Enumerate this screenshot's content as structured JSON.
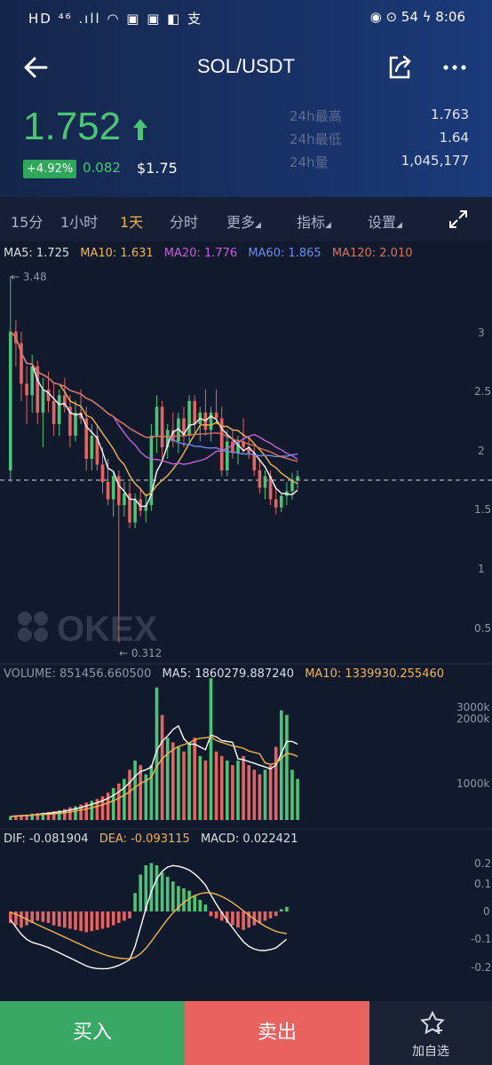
{
  "status_bar": {
    "left": "HD ⁴⁶ .ıll ◠ ▣ ▣ ◧ 支",
    "right": "◉ ⊙ 54 ϟ 8:06"
  },
  "nav": {
    "title": "SOL/USDT"
  },
  "ticker": {
    "price": "1.752",
    "change_pct": "+4.92%",
    "change_abs": "0.082",
    "usd_price": "$1.75",
    "stats": [
      {
        "label": "24h最高",
        "value": "1.763"
      },
      {
        "label": "24h最低",
        "value": "1.64"
      },
      {
        "label": "24h量",
        "value": "1,045,177"
      }
    ]
  },
  "tabs": {
    "items": [
      "15分",
      "1小时",
      "1天",
      "分时",
      "更多",
      "指标",
      "设置"
    ],
    "active": "1天"
  },
  "ma_legend": {
    "ma5": "MA5: 1.725",
    "ma10": "MA10: 1.631",
    "ma20": "MA20: 1.776",
    "ma60": "MA60: 1.865",
    "ma120": "MA120: 2.010"
  },
  "price_axis": {
    "ticks": [
      "3",
      "2.5",
      "2",
      "1.5",
      "1",
      "0.5"
    ],
    "high_marker": "3.48",
    "low_marker": "0.312",
    "watermark": "OKEX"
  },
  "volume_legend": {
    "volume": "VOLUME: 851456.660500",
    "ma5": "MA5: 1860279.887240",
    "ma10": "MA10: 1339930.255460"
  },
  "volume_axis": {
    "ticks": [
      "3000k",
      "2000k",
      "1000k"
    ]
  },
  "macd_legend": {
    "dif": "DIF: -0.081904",
    "dea": "DEA: -0.093115",
    "macd": "MACD: 0.022421"
  },
  "macd_axis": {
    "ticks": [
      "0.2",
      "0.1",
      "0",
      "-0.1",
      "-0.2"
    ]
  },
  "actions": {
    "buy": "买入",
    "sell": "卖出",
    "favorite": "加自选"
  },
  "colors": {
    "up": "#49c574",
    "down": "#e8625f",
    "ma5": "#ffffff",
    "ma10": "#f0b64e",
    "ma20": "#c462d8",
    "ma60": "#6c8cf0",
    "ma120": "#d9735a"
  },
  "chart_data": {
    "type": "candlestick",
    "price_range": [
      0.25,
      3.55
    ],
    "candles": [
      {
        "o": 1.8,
        "h": 3.48,
        "l": 1.7,
        "c": 3.0
      },
      {
        "o": 3.0,
        "h": 3.1,
        "l": 2.7,
        "c": 2.9
      },
      {
        "o": 2.9,
        "h": 3.0,
        "l": 2.4,
        "c": 2.55
      },
      {
        "o": 2.55,
        "h": 2.7,
        "l": 2.2,
        "c": 2.45
      },
      {
        "o": 2.45,
        "h": 2.8,
        "l": 2.3,
        "c": 2.7
      },
      {
        "o": 2.7,
        "h": 2.75,
        "l": 2.2,
        "c": 2.3
      },
      {
        "o": 2.3,
        "h": 2.6,
        "l": 2.0,
        "c": 2.5
      },
      {
        "o": 2.5,
        "h": 2.65,
        "l": 2.3,
        "c": 2.4
      },
      {
        "o": 2.4,
        "h": 2.55,
        "l": 2.1,
        "c": 2.2
      },
      {
        "o": 2.2,
        "h": 2.5,
        "l": 2.1,
        "c": 2.45
      },
      {
        "o": 2.45,
        "h": 2.6,
        "l": 2.3,
        "c": 2.35
      },
      {
        "o": 2.35,
        "h": 2.45,
        "l": 2.0,
        "c": 2.1
      },
      {
        "o": 2.1,
        "h": 2.4,
        "l": 2.05,
        "c": 2.3
      },
      {
        "o": 2.3,
        "h": 2.5,
        "l": 2.2,
        "c": 2.25
      },
      {
        "o": 2.25,
        "h": 2.35,
        "l": 1.8,
        "c": 1.9
      },
      {
        "o": 1.9,
        "h": 2.2,
        "l": 1.8,
        "c": 2.1
      },
      {
        "o": 2.1,
        "h": 2.2,
        "l": 1.8,
        "c": 1.85
      },
      {
        "o": 1.85,
        "h": 2.0,
        "l": 1.6,
        "c": 1.7
      },
      {
        "o": 1.7,
        "h": 1.9,
        "l": 1.5,
        "c": 1.55
      },
      {
        "o": 1.55,
        "h": 1.8,
        "l": 1.4,
        "c": 1.75
      },
      {
        "o": 1.75,
        "h": 1.8,
        "l": 0.312,
        "c": 1.5
      },
      {
        "o": 1.5,
        "h": 1.7,
        "l": 1.4,
        "c": 1.6
      },
      {
        "o": 1.6,
        "h": 1.7,
        "l": 1.3,
        "c": 1.35
      },
      {
        "o": 1.35,
        "h": 1.6,
        "l": 1.3,
        "c": 1.55
      },
      {
        "o": 1.55,
        "h": 1.65,
        "l": 1.4,
        "c": 1.45
      },
      {
        "o": 1.45,
        "h": 1.6,
        "l": 1.35,
        "c": 1.5
      },
      {
        "o": 1.5,
        "h": 2.2,
        "l": 1.45,
        "c": 2.1
      },
      {
        "o": 2.1,
        "h": 2.45,
        "l": 1.95,
        "c": 2.35
      },
      {
        "o": 2.35,
        "h": 2.4,
        "l": 1.9,
        "c": 2.0
      },
      {
        "o": 2.0,
        "h": 2.2,
        "l": 1.9,
        "c": 2.15
      },
      {
        "o": 2.15,
        "h": 2.3,
        "l": 2.0,
        "c": 2.05
      },
      {
        "o": 2.05,
        "h": 2.3,
        "l": 1.95,
        "c": 2.25
      },
      {
        "o": 2.25,
        "h": 2.35,
        "l": 2.0,
        "c": 2.1
      },
      {
        "o": 2.1,
        "h": 2.45,
        "l": 2.05,
        "c": 2.4
      },
      {
        "o": 2.4,
        "h": 2.45,
        "l": 2.1,
        "c": 2.2
      },
      {
        "o": 2.2,
        "h": 2.35,
        "l": 2.05,
        "c": 2.3
      },
      {
        "o": 2.3,
        "h": 2.5,
        "l": 2.1,
        "c": 2.15
      },
      {
        "o": 2.15,
        "h": 2.35,
        "l": 2.05,
        "c": 2.3
      },
      {
        "o": 2.3,
        "h": 2.5,
        "l": 2.2,
        "c": 2.25
      },
      {
        "o": 2.25,
        "h": 2.35,
        "l": 1.75,
        "c": 1.8
      },
      {
        "o": 1.8,
        "h": 2.15,
        "l": 1.75,
        "c": 2.05
      },
      {
        "o": 2.05,
        "h": 2.15,
        "l": 1.9,
        "c": 1.95
      },
      {
        "o": 1.95,
        "h": 2.1,
        "l": 1.85,
        "c": 2.05
      },
      {
        "o": 2.05,
        "h": 2.25,
        "l": 1.95,
        "c": 2.0
      },
      {
        "o": 2.0,
        "h": 2.1,
        "l": 1.9,
        "c": 1.95
      },
      {
        "o": 1.95,
        "h": 2.0,
        "l": 1.75,
        "c": 1.8
      },
      {
        "o": 1.8,
        "h": 1.9,
        "l": 1.6,
        "c": 1.65
      },
      {
        "o": 1.65,
        "h": 1.8,
        "l": 1.55,
        "c": 1.75
      },
      {
        "o": 1.75,
        "h": 1.8,
        "l": 1.5,
        "c": 1.55
      },
      {
        "o": 1.55,
        "h": 1.65,
        "l": 1.42,
        "c": 1.48
      },
      {
        "o": 1.48,
        "h": 1.6,
        "l": 1.44,
        "c": 1.58
      },
      {
        "o": 1.58,
        "h": 1.7,
        "l": 1.5,
        "c": 1.62
      },
      {
        "o": 1.62,
        "h": 1.78,
        "l": 1.55,
        "c": 1.72
      },
      {
        "o": 1.72,
        "h": 1.8,
        "l": 1.64,
        "c": 1.75
      }
    ],
    "volumes": [
      80,
      95,
      110,
      120,
      140,
      150,
      160,
      175,
      190,
      210,
      240,
      280,
      300,
      340,
      380,
      420,
      460,
      520,
      600,
      700,
      800,
      900,
      1100,
      1300,
      1200,
      1000,
      1200,
      2900,
      2300,
      1800,
      1700,
      1600,
      1500,
      1700,
      1800,
      1400,
      1300,
      3100,
      1500,
      1400,
      1300,
      1200,
      1300,
      1400,
      1200,
      1100,
      1000,
      1100,
      1200,
      1600,
      2400,
      2300,
      1100,
      900
    ],
    "macd_hist": [
      -0.05,
      -0.06,
      -0.07,
      -0.06,
      -0.05,
      -0.04,
      -0.045,
      -0.05,
      -0.06,
      -0.065,
      -0.07,
      -0.075,
      -0.08,
      -0.085,
      -0.09,
      -0.085,
      -0.08,
      -0.075,
      -0.07,
      -0.06,
      -0.05,
      -0.04,
      -0.03,
      0.08,
      0.16,
      0.2,
      0.21,
      0.2,
      0.17,
      0.15,
      0.13,
      0.11,
      0.1,
      0.09,
      0.07,
      0.05,
      0.03,
      -0.02,
      -0.03,
      -0.04,
      -0.05,
      -0.06,
      -0.07,
      -0.08,
      -0.07,
      -0.06,
      -0.05,
      -0.04,
      -0.03,
      -0.02,
      0.01,
      0.02
    ]
  }
}
